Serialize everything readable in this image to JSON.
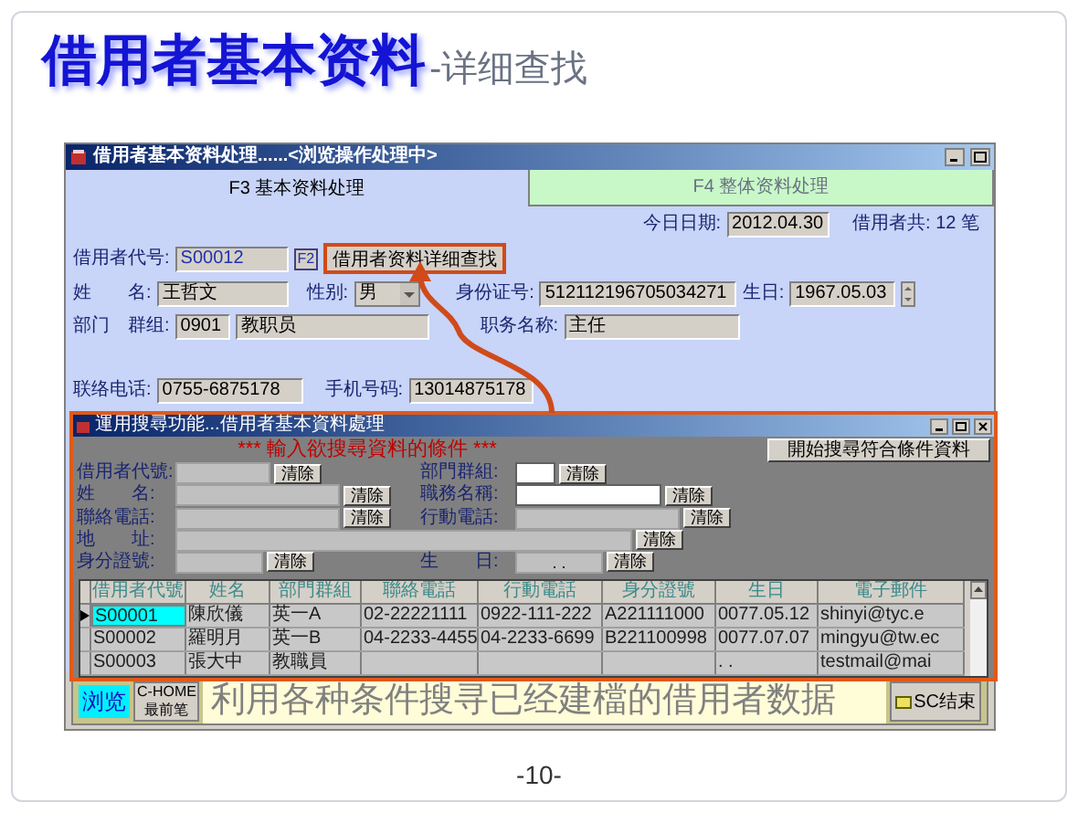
{
  "heading": {
    "main": "借用者基本资料",
    "sub": "-详细查找"
  },
  "main_window": {
    "title": "借用者基本资料处理......<浏览操作处理中>",
    "tabs": [
      {
        "label": "F3 基本资料处理",
        "selected": true
      },
      {
        "label": "F4 整体资料处理",
        "selected": false
      }
    ],
    "today": {
      "label": "今日日期:",
      "value": "2012.04.30"
    },
    "count": "借用者共: 12 笔",
    "borrower_id": {
      "label": "借用者代号:",
      "value": "S00012",
      "key": "F2"
    },
    "detail_search_button": "借用者资料详细查找",
    "name": {
      "label": "姓　　名:",
      "value": "王哲文"
    },
    "gender": {
      "label": "性别:",
      "value": "男"
    },
    "id_number": {
      "label": "身份证号:",
      "value": "512112196705034271"
    },
    "birthday": {
      "label": "生日:",
      "value": "1967.05.03"
    },
    "department": {
      "label": "部门　群组:",
      "code": "0901",
      "value": "教职员"
    },
    "job_title": {
      "label": "职务名称:",
      "value": "主任"
    },
    "phone": {
      "label": "联络电话:",
      "value": "0755-6875178"
    },
    "mobile": {
      "label": "手机号码:",
      "value": "13014875178"
    }
  },
  "search_dialog": {
    "title": "運用搜尋功能...借用者基本資料處理",
    "heading": "*** 輸入欲搜尋資料的條件 ***",
    "start_button": "開始搜尋符合條件資料",
    "criteria": [
      [
        {
          "label": "借用者代號:",
          "clear": "清除",
          "highlighted": false
        },
        {
          "label": "部門群組:",
          "clear": "清除",
          "highlighted": true
        }
      ],
      [
        {
          "label": "姓　　名:",
          "clear": "清除",
          "highlighted": false
        },
        {
          "label": "職務名稱:",
          "clear": "清除",
          "highlighted": true
        }
      ],
      [
        {
          "label": "聯絡電話:",
          "clear": "清除",
          "highlighted": false
        },
        {
          "label": "行動電話:",
          "clear": "清除",
          "highlighted": false
        }
      ],
      [
        {
          "label": "地　　址:",
          "clear": "清除",
          "highlighted": false
        }
      ],
      [
        {
          "label": "身分證號:",
          "clear": "清除",
          "highlighted": false
        },
        {
          "label": "生　　日:",
          "value": ".  .",
          "clear": "清除",
          "highlighted": false
        }
      ]
    ],
    "table": {
      "columns": [
        "借用者代號",
        "姓名",
        "部門群組",
        "聯絡電話",
        "行動電話",
        "身分證號",
        "生日",
        "電子郵件"
      ],
      "rows": [
        {
          "selected": true,
          "cells": [
            "S00001",
            "陳欣儀",
            "英一A",
            "02-22221111",
            "0922-111-222",
            "A221111000",
            "0077.05.12",
            "shinyi@tyc.e"
          ]
        },
        {
          "selected": false,
          "cells": [
            "S00002",
            "羅明月",
            "英一B",
            "04-2233-4455",
            "04-2233-6699",
            "B221100998",
            "0077.07.07",
            "mingyu@tw.ec"
          ]
        },
        {
          "selected": false,
          "cells": [
            "S00003",
            "張大中",
            "教職員",
            null,
            null,
            null,
            ".  .",
            "testmail@mai"
          ]
        }
      ]
    }
  },
  "bottom_bar": {
    "mode": "浏览",
    "first_button": "C-HOME\n最前笔",
    "caption": "利用各种条件搜寻已经建檔的借用者数据",
    "exit_button": "SC结束"
  },
  "page_number": "-10-"
}
